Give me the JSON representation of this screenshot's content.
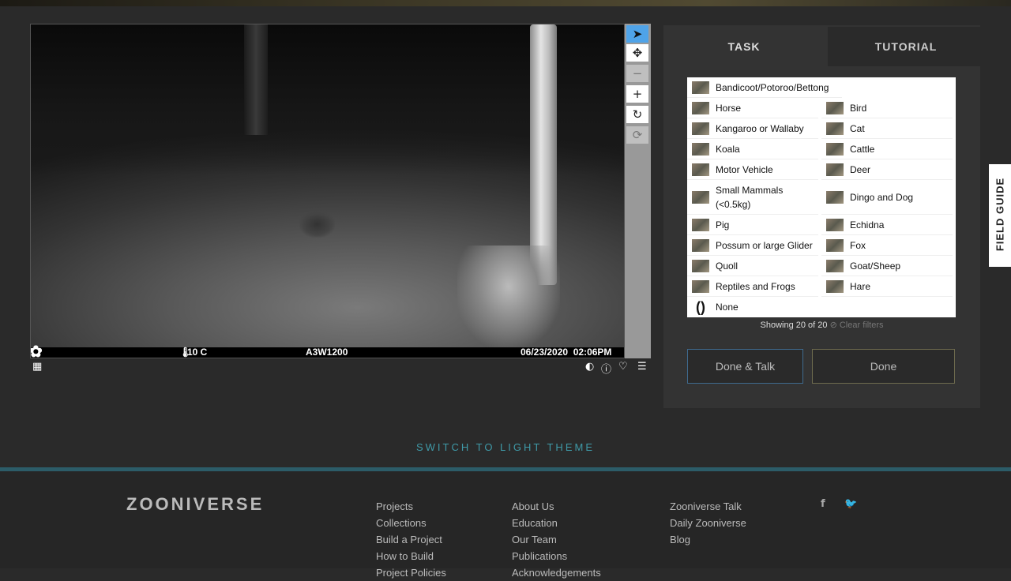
{
  "viewer": {
    "camera": {
      "temperature": "10 C",
      "camera_id": "A3W1200",
      "datetime": "06/23/2020  02:06PM"
    }
  },
  "task": {
    "tabs": [
      "TASK",
      "TUTORIAL"
    ],
    "choices": [
      "Bandicoot/Potoroo/Bettong",
      "Horse",
      "Bird",
      "Kangaroo or Wallaby",
      "Cat",
      "Koala",
      "Cattle",
      "Motor Vehicle",
      "Deer",
      "Small Mammals (<0.5kg)",
      "Dingo and Dog",
      "Pig",
      "Echidna",
      "Possum or large Glider",
      "Fox",
      "Quoll",
      "Goat/Sheep",
      "Reptiles and Frogs",
      "Hare",
      "None"
    ],
    "showing": "Showing 20 of 20",
    "clear_filters": "Clear filters",
    "buttons": {
      "done_talk": "Done & Talk",
      "done": "Done"
    }
  },
  "field_guide": "FIELD GUIDE",
  "theme_switch": "SWITCH TO LIGHT THEME",
  "footer": {
    "logo": "ZOONIVERSE",
    "col1": [
      "Projects",
      "Collections",
      "Build a Project",
      "How to Build",
      "Project Policies"
    ],
    "col2": [
      "About Us",
      "Education",
      "Our Team",
      "Publications",
      "Acknowledgements"
    ],
    "col3": [
      "Zooniverse Talk",
      "Daily Zooniverse",
      "Blog"
    ],
    "social": [
      "facebook-icon",
      "twitter-icon"
    ]
  },
  "colors": {
    "accent": "#3f9aa8",
    "active_tool": "#4fa3e8"
  }
}
